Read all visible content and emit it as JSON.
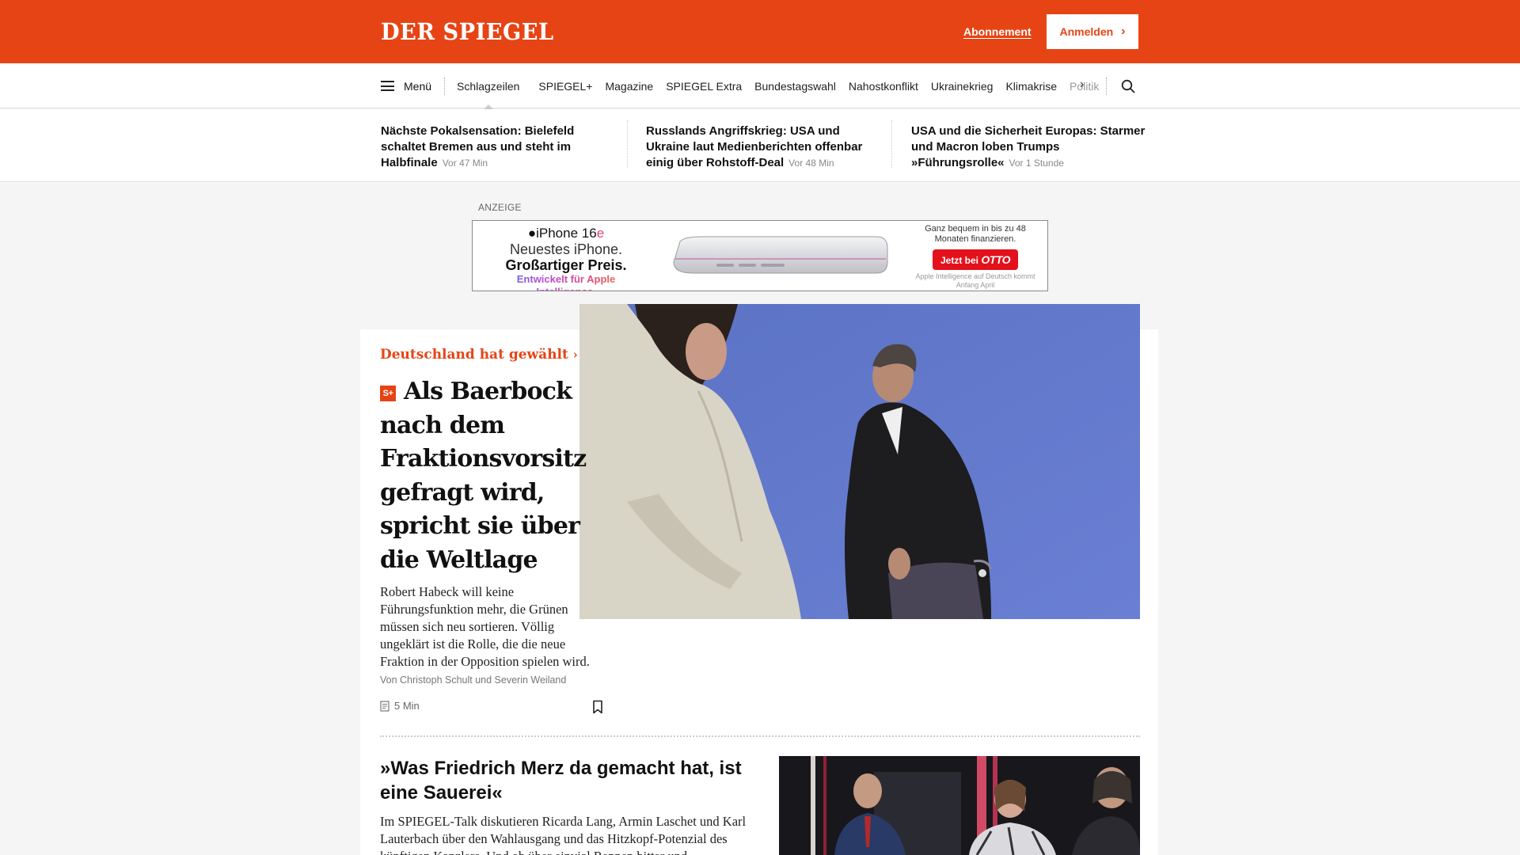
{
  "header": {
    "logo": "DER SPIEGEL",
    "subscription_link": "Abonnement",
    "login_button": "Anmelden",
    "accent_color": "#e64415"
  },
  "nav": {
    "menu_label": "Menü",
    "items": [
      "Schlagzeilen",
      "SPIEGEL+",
      "Magazine",
      "SPIEGEL Extra",
      "Bundestagswahl",
      "Nahostkonflikt",
      "Ukrainekrieg",
      "Klimakrise",
      "Politik"
    ],
    "icons": [
      "hamburger-icon",
      "chevron-right-icon",
      "search-icon"
    ]
  },
  "top_teasers": [
    {
      "title": "Nächste Pokalsensation: Bielefeld schaltet Bremen aus und steht im Halbfinale",
      "time": "Vor 47 Min"
    },
    {
      "title": "Russlands Angriffskrieg: USA und Ukraine laut Medienberichten offenbar einig über Rohstoff-Deal",
      "time": "Vor 48 Min"
    },
    {
      "title": "USA und die Sicherheit Europas: Starmer und Macron loben Trumps »Führungsrolle«",
      "time": "Vor 1 Stunde"
    }
  ],
  "ad": {
    "label": "ANZEIGE",
    "product_prefix": "iPhone 16",
    "product_suffix": "e",
    "line1": "Neuestes iPhone.",
    "line2": "Großartiger Preis.",
    "line3": "Entwickelt für Apple Intelligence.",
    "finance_text": "Ganz bequem in bis zu 48 Monaten finanzieren.",
    "cta_prefix": "Jetzt bei",
    "cta_brand": "OTTO",
    "disclaimer": "Apple Intelligence auf Deutsch kommt Anfang April"
  },
  "lead_article": {
    "kicker": "Deutschland hat gewählt",
    "badge": "S+",
    "headline": "Als Baerbock nach dem Fraktionsvorsitz gefragt wird, spricht sie über die Weltlage",
    "teaser": "Robert Habeck will keine Führungsfunktion mehr, die Grünen müssen sich neu sortieren. Völlig ungeklärt ist die Rolle, die die neue Fraktion in der Opposition spielen wird.",
    "byline": "Von Christoph Schult und Severin Weiland",
    "read_time": "5 Min"
  },
  "second_article": {
    "headline": "»Was Friedrich Merz da gemacht hat, ist eine Sauerei«",
    "teaser": "Im SPIEGEL-Talk diskutieren Ricarda Lang, Armin Laschet und Karl Lauterbach über den Wahlausgang und das Hitzkopf-Potenzial des künftigen Kanzlers. Und ob über einvial Rennen bitter und"
  }
}
